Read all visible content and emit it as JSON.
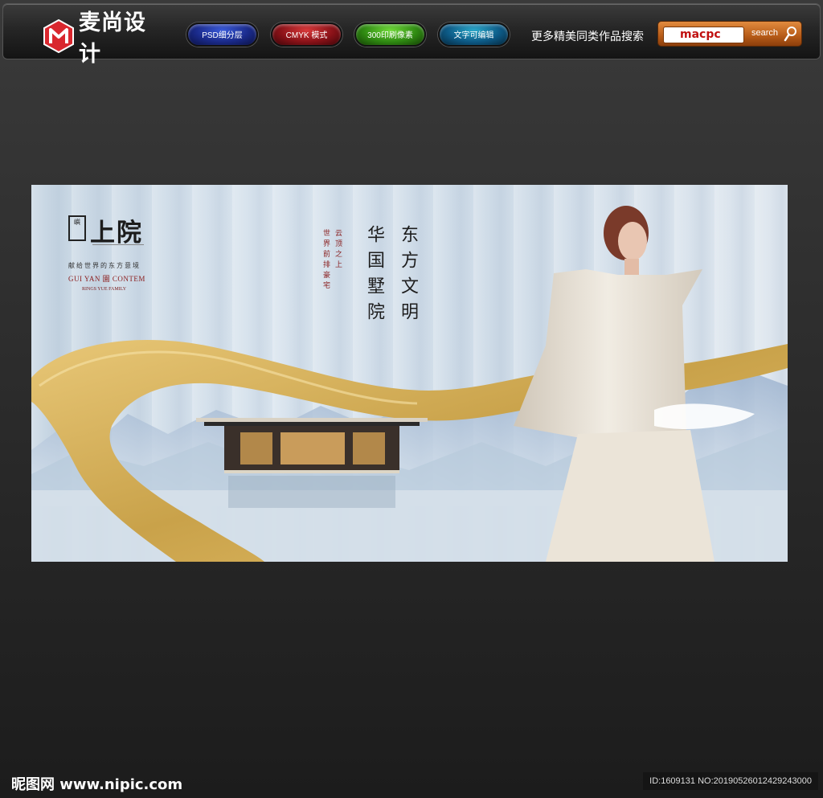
{
  "header": {
    "brand_text": "麦尚设计",
    "tags": [
      "PSD细分层",
      "CMYK 模式",
      "300印刷像素",
      "文字可编辑"
    ],
    "search_caption": "更多精美同类作品搜索",
    "search_value": "macpc",
    "search_button": "search"
  },
  "poster": {
    "brand_name": "上院",
    "brand_seal": "嶼",
    "brand_tagline": "献给世界的东方意境",
    "brand_en": "GUI YAN 園 CONTEM",
    "brand_en_sub": "RINGS YUE FAMILY",
    "headline_col1": "东方文明",
    "headline_col2": "华国墅院",
    "sub_col1": "云顶之上",
    "sub_col2": "世界前排豪宅"
  },
  "footer": {
    "watermark": "昵图网 www.nipic.com",
    "image_id": "ID:1609131 NO:20190526012429243000"
  },
  "colors": {
    "accent_gold": "#d9b35a",
    "search_orange": "#c06a22",
    "background": "#2a2a2a"
  }
}
